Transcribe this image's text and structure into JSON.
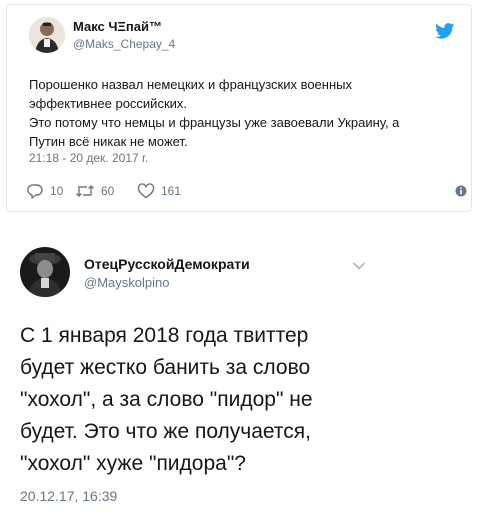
{
  "tweet1": {
    "author_name": "Макс ЧΞпай™",
    "handle": "@Maks_Chepay_4",
    "text_lines": [
      "Порошенко назвал немецких и французских военных",
      "эффективнее российских.",
      "Это потому что немцы и французы уже завоевали Украину, а",
      "Путин всё никак не может."
    ],
    "timestamp": "21:18 - 20 дек. 2017 г.",
    "reply_count": "10",
    "retweet_count": "60",
    "like_count": "161",
    "icons": [
      "avatar",
      "twitter-bird-icon",
      "reply-icon",
      "retweet-icon",
      "heart-icon",
      "info-icon"
    ],
    "colors": {
      "bird": "#1da1f2",
      "meta": "#657786"
    }
  },
  "tweet2": {
    "author_name": "ОтецРусскойДемократи",
    "handle": "@Mayskolpino",
    "text_lines": [
      "С 1 января 2018 года твиттер",
      "будет жестко банить за слово",
      "\"хохол\", а за слово \"пидор\" не",
      "будет. Это что же получается,",
      "\"хохол\" хуже \"пидора\"?"
    ],
    "timestamp": "20.12.17, 16:39",
    "icons": [
      "avatar",
      "chevron-down-icon"
    ]
  }
}
